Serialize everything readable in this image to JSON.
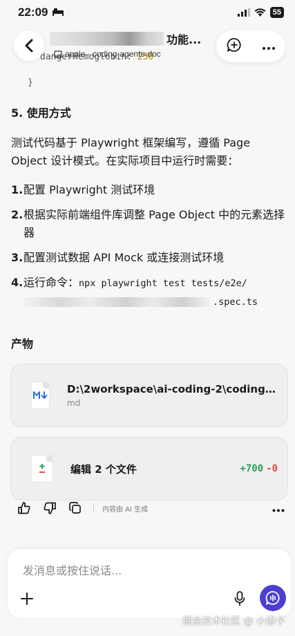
{
  "status": {
    "time": "22:09",
    "battery": "55"
  },
  "header": {
    "title_suffix": "功能...",
    "subtitle": "apple · coding-agents-doc"
  },
  "code_tail": {
    "key": "dangerHemoglobin:",
    "value": "250",
    "brace": "}"
  },
  "content": {
    "section_heading": "5. 使用方式",
    "paragraph": "测试代码基于 Playwright 框架编写，遵循 Page Object 设计模式。在实际项目中运行时需要：",
    "steps": [
      {
        "num": "1.",
        "text": "配置 Playwright 测试环境"
      },
      {
        "num": "2.",
        "text": "根据实际前端组件库调整 Page Object 中的元素选择器"
      },
      {
        "num": "3.",
        "text": "配置测试数据 API Mock 或连接测试环境"
      },
      {
        "num": "4.",
        "text": "运行命令：",
        "code_start": "npx playwright test tests/e2e/",
        "code_end": ".spec.ts"
      }
    ],
    "artifacts_heading": "产物",
    "file_card": {
      "title": "D:\\2workspace\\ai-coding-2\\coding-...",
      "ext": "md"
    },
    "edit_card": {
      "title": "编辑 2 个文件",
      "added": "+700",
      "removed": "-0"
    }
  },
  "feedback": {
    "note": "内容由 AI 生成"
  },
  "input": {
    "placeholder": "发消息或按住说话..."
  },
  "watermark": "掘金技术社区 @ 小懋子"
}
